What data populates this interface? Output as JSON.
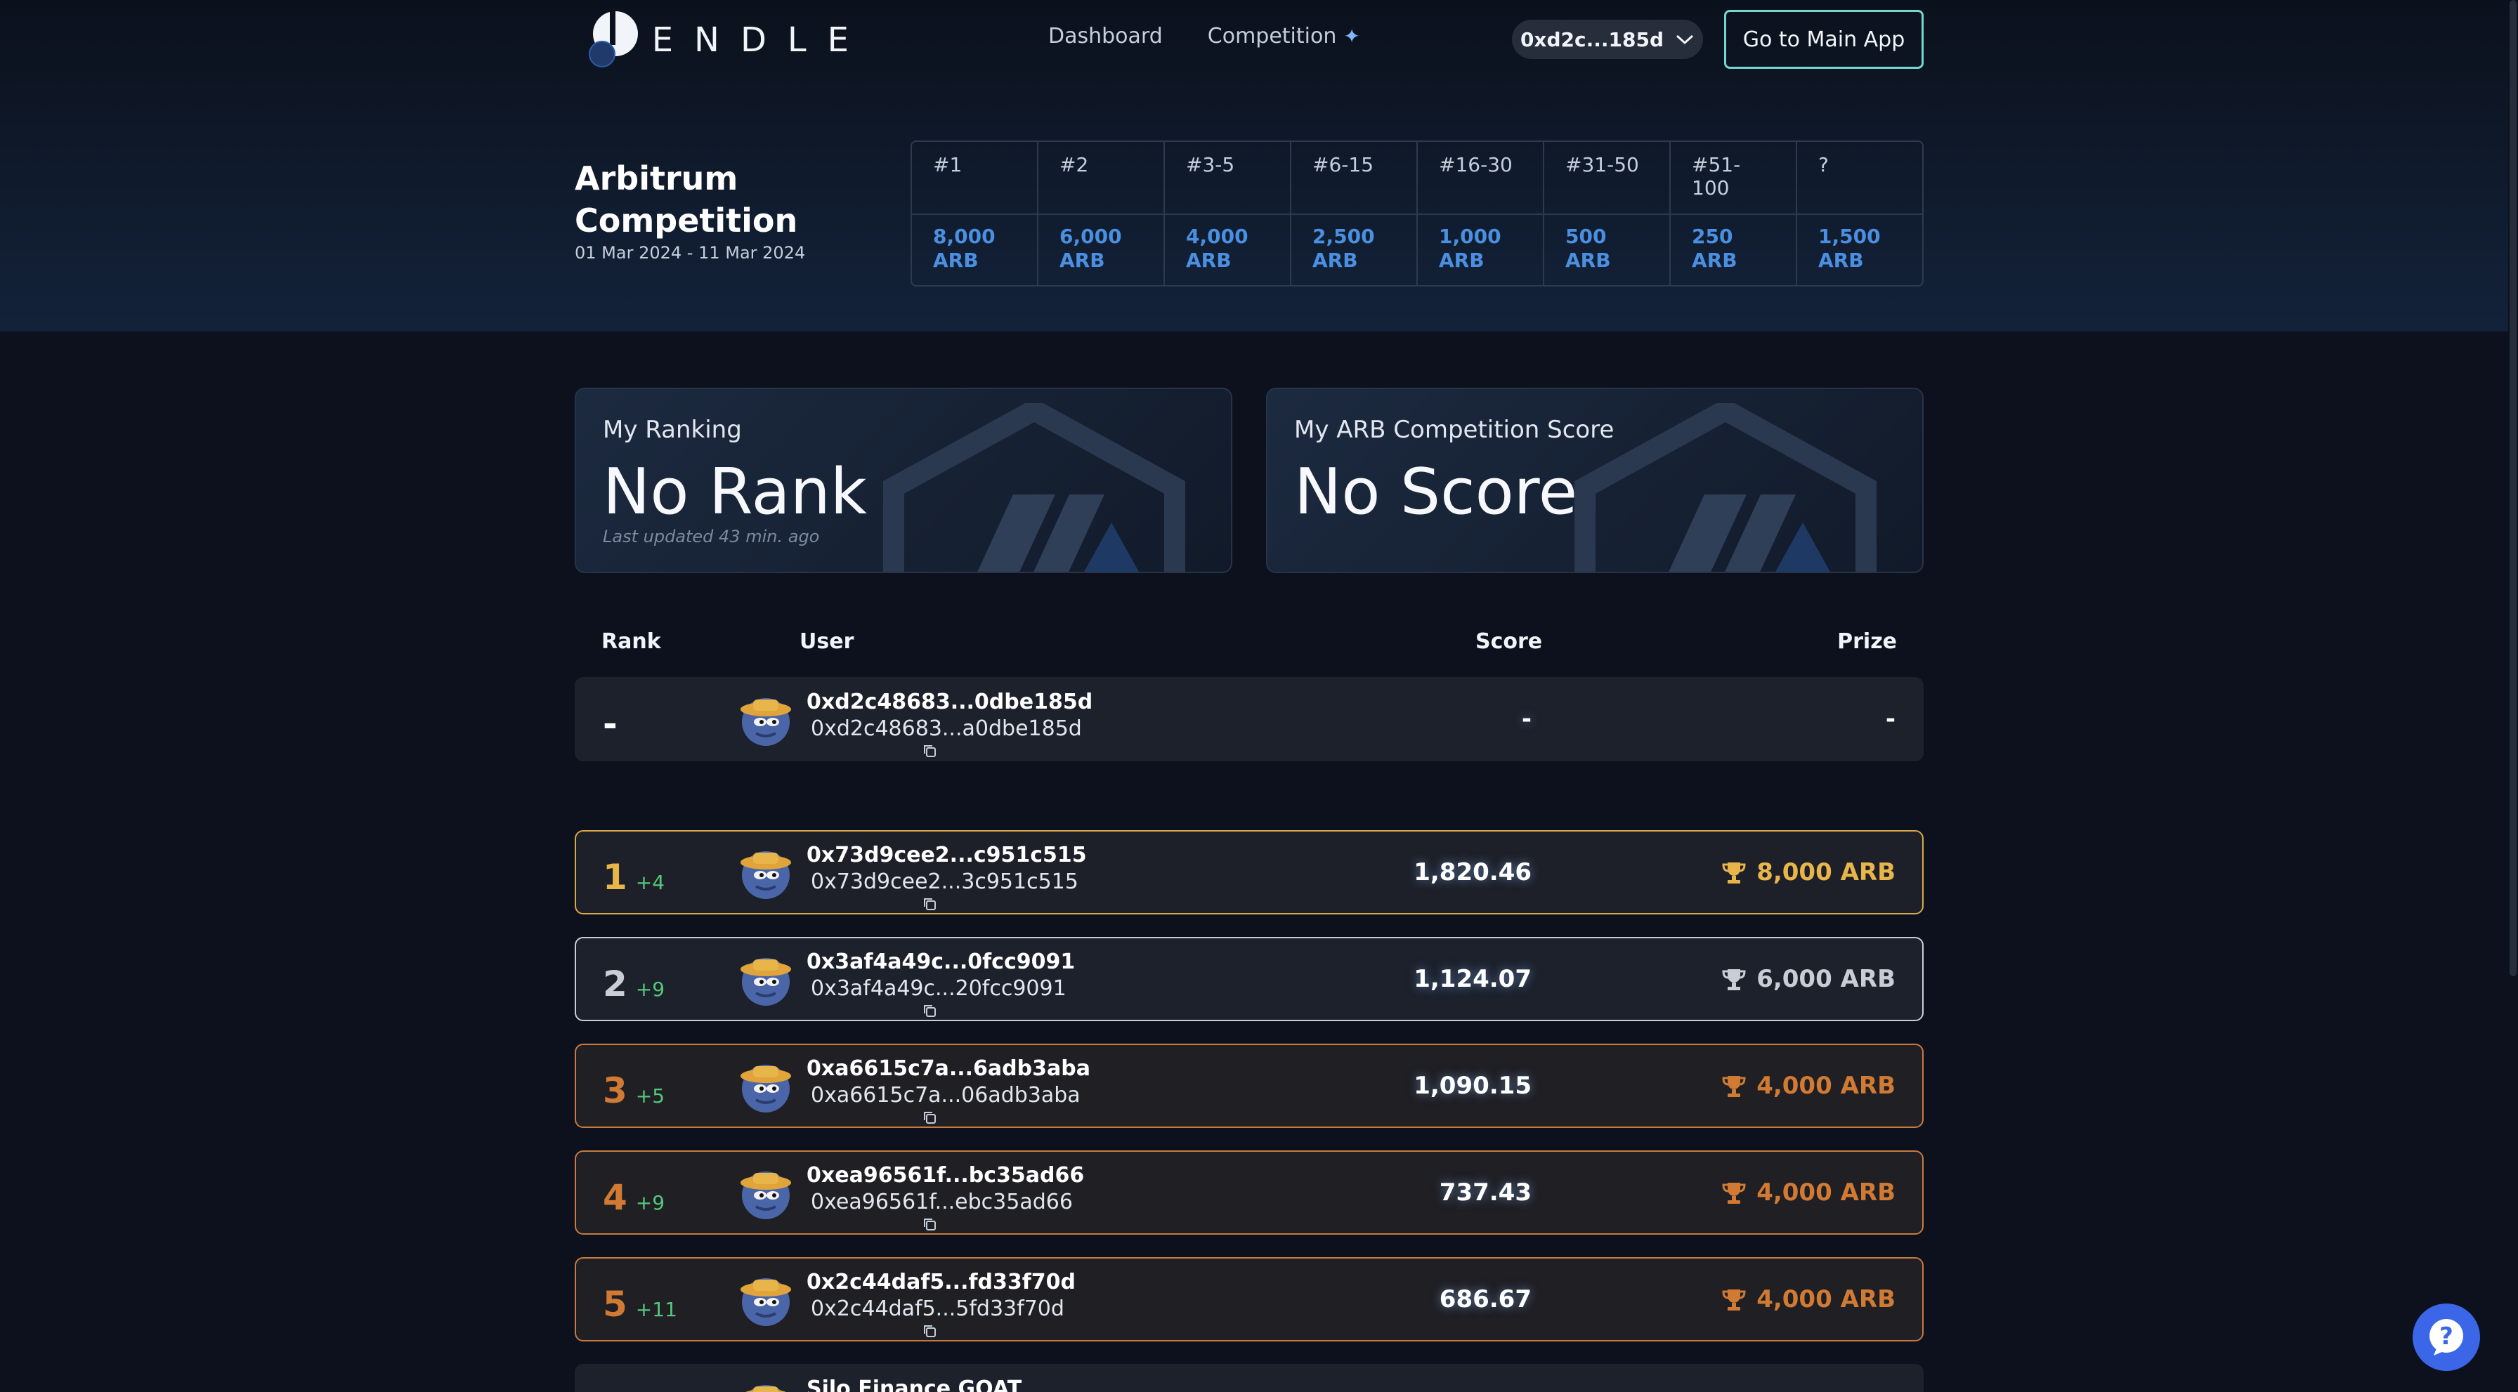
{
  "nav": {
    "brand": "PENDLE",
    "links": [
      "Dashboard",
      "Competition"
    ],
    "wallet": "0xd2c...185d",
    "main_app": "Go to Main App"
  },
  "competition": {
    "title_line1": "Arbitrum",
    "title_line2": "Competition",
    "dates": "01 Mar 2024 - 11 Mar 2024",
    "prizes": [
      {
        "rank": "#1",
        "amount": "8,000",
        "unit": "ARB"
      },
      {
        "rank": "#2",
        "amount": "6,000",
        "unit": "ARB"
      },
      {
        "rank": "#3-5",
        "amount": "4,000",
        "unit": "ARB"
      },
      {
        "rank": "#6-15",
        "amount": "2,500",
        "unit": "ARB"
      },
      {
        "rank": "#16-30",
        "amount": "1,000",
        "unit": "ARB"
      },
      {
        "rank": "#31-50",
        "amount": "500",
        "unit": "ARB"
      },
      {
        "rank": "#51-100",
        "amount": "250",
        "unit": "ARB"
      },
      {
        "rank": "?",
        "amount": "1,500",
        "unit": "ARB"
      }
    ]
  },
  "cards": {
    "ranking_label": "My Ranking",
    "ranking_value": "No Rank",
    "updated": "Last updated 43 min. ago",
    "score_label": "My ARB Competition Score",
    "score_value": "No Score"
  },
  "table": {
    "headers": {
      "rank": "Rank",
      "user": "User",
      "score": "Score",
      "prize": "Prize"
    },
    "my_row": {
      "rank": "-",
      "user": "0xd2c48683...0dbe185d",
      "sub": "0xd2c48683...a0dbe185d",
      "score": "-",
      "prize": "-"
    },
    "rows": [
      {
        "rank": "1",
        "delta": "+4",
        "user": "0x73d9cee2...c951c515",
        "sub": "0x73d9cee2...3c951c515",
        "score": "1,820.46",
        "prize": "8,000 ARB",
        "tier": "gold"
      },
      {
        "rank": "2",
        "delta": "+9",
        "user": "0x3af4a49c...0fcc9091",
        "sub": "0x3af4a49c...20fcc9091",
        "score": "1,124.07",
        "prize": "6,000 ARB",
        "tier": "silver"
      },
      {
        "rank": "3",
        "delta": "+5",
        "user": "0xa6615c7a...6adb3aba",
        "sub": "0xa6615c7a...06adb3aba",
        "score": "1,090.15",
        "prize": "4,000 ARB",
        "tier": "bronze"
      },
      {
        "rank": "4",
        "delta": "+9",
        "user": "0xea96561f...bc35ad66",
        "sub": "0xea96561f...ebc35ad66",
        "score": "737.43",
        "prize": "4,000 ARB",
        "tier": "bronze"
      },
      {
        "rank": "5",
        "delta": "+11",
        "user": "0x2c44daf5...fd33f70d",
        "sub": "0x2c44daf5...5fd33f70d",
        "score": "686.67",
        "prize": "4,000 ARB",
        "tier": "bronze"
      },
      {
        "rank": "",
        "delta": "",
        "user": "Silo Finance GOAT",
        "sub": "",
        "score": "",
        "prize": "",
        "tier": "plain"
      }
    ]
  },
  "colors": {
    "gold": "#e8b54a",
    "silver": "#c9ced6",
    "bronze": "#d07a34",
    "accent": "#4a8fe0",
    "positive": "#55c87a"
  },
  "icons": {
    "copy": "copy-icon",
    "trophy": "trophy-icon",
    "chevron": "chevron-down-icon",
    "help": "help-icon"
  }
}
